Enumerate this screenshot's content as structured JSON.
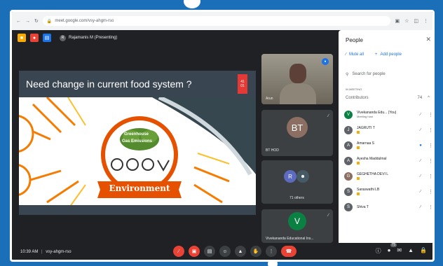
{
  "browser": {
    "url": "meet.google.com/vsy-ahgm-rso"
  },
  "appbar": {
    "presenting": "Rajamanis M (Presenting)"
  },
  "slide": {
    "title": "Need change in current food system ?",
    "badge_line1": "41",
    "badge_line2": "01",
    "greenhouse": "Greenhouse",
    "emissions": "Gas Emissions",
    "environment": "Environment"
  },
  "tiles": [
    {
      "name": "Arun",
      "initials": ""
    },
    {
      "name": "BT HOD",
      "initials": "BT"
    },
    {
      "name": "71 others",
      "initials": "R"
    },
    {
      "name": "Vivekananda Educational Ins...",
      "initials": "V"
    }
  ],
  "people": {
    "title": "People",
    "mute_all": "Mute all",
    "add_people": "Add people",
    "search_placeholder": "Search for people",
    "section": "IN MEETING",
    "contributors_label": "Contributors",
    "contributors_count": "74",
    "list": [
      {
        "name": "Vivekananda Edu... (You)",
        "sub": "Meeting host",
        "initial": "V",
        "color": "#0b8043"
      },
      {
        "name": "JAGRUTI T",
        "sub": "",
        "initial": "J",
        "color": "#5f6368"
      },
      {
        "name": "Amarnaa S",
        "sub": "",
        "initial": "A",
        "color": "#5f6368"
      },
      {
        "name": "Ayesha Maddulmal",
        "sub": "",
        "initial": "A",
        "color": "#5f6368"
      },
      {
        "name": "GEGHETHA DEVI L",
        "sub": "",
        "initial": "G",
        "color": "#8d6e63"
      },
      {
        "name": "Saraswathi LB",
        "sub": "",
        "initial": "S",
        "color": "#5f6368"
      },
      {
        "name": "Shiva T",
        "sub": "",
        "initial": "S",
        "color": "#5f6368"
      }
    ]
  },
  "bottom": {
    "time": "10:39 AM",
    "meeting_code": "vsy-ahgm-rso",
    "participants_badge": "75"
  },
  "colors": {
    "accent": "#1a73e8",
    "danger": "#ea4335",
    "frame_bg": "#202124"
  }
}
